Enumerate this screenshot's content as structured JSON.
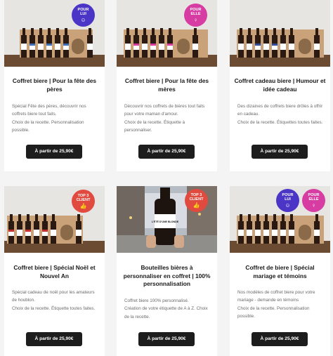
{
  "colors": {
    "lui": "#4a35c6",
    "elle": "#d63ca1",
    "top": "#e14a3e",
    "button": "#1d1d1d"
  },
  "cards": [
    {
      "title": "Coffret biere | Pour la fête des pères",
      "description": "Spécial Fête des pères, découvrir nos coffrets biere tout faits.\nChoix de la recette. Personnalisation possible.",
      "button": "À partir de 25,90€",
      "badges": [
        {
          "line1": "POUR",
          "line2": "LUI",
          "icon": "male-face-icon"
        }
      ]
    },
    {
      "title": "Coffret biere | Pour la fête des mères",
      "description": "Découvrir nos coffrets de bières tout faits pour votre maman d'amour.\nChoix de la recette. Étiquette à personnaliser.",
      "button": "À partir de 25,90€",
      "badges": [
        {
          "line1": "POUR",
          "line2": "ELLE",
          "icon": "female-face-icon"
        }
      ]
    },
    {
      "title": "Coffret cadeau biere | Humour et idée cadeau",
      "description": "Des dizaines de coffrets biere drôles à offrir en cadeau.\nChoix de la recette. Étiquettes toutes faites.",
      "button": "À partir de 25,90€",
      "badges": []
    },
    {
      "title": "Coffret biere | Spécial Noël et Nouvel An",
      "description": "Spécial cadeau de noël pour les amateurs de houblon.\nChoix de la recette. Étiquette toutes faites.",
      "button": "À partir de 25,90€",
      "badges": [
        {
          "line1": "TOP 3",
          "line2": "CLIENT",
          "icon": "thumbs-up-icon"
        }
      ]
    },
    {
      "title": "Bouteilles bières à personnaliser en coffret | 100% personnalisation",
      "description": "Coffret biere 100% personnalisé.\nCréation de votre étiquette de A à Z. Choix de la recette.",
      "button": "À partir de 25,90€",
      "photo_label": "L'ÉTÉ D'UNE BLONDE",
      "badges": [
        {
          "line1": "TOP 3",
          "line2": "CLIENT",
          "icon": "thumbs-up-icon"
        }
      ]
    },
    {
      "title": "Coffret de biere | Spécial mariage et témoins",
      "description": "Nos modèles de coffret biere pour votre mariage - demande en témoins\nChoix de la recette. Personnalisation possible.",
      "button": "À partir de 25,90€",
      "badges": [
        {
          "line1": "POUR",
          "line2": "LUI",
          "icon": "male-face-icon"
        },
        {
          "line1": "POUR",
          "line2": "ELLE",
          "icon": "female-face-icon"
        }
      ]
    }
  ]
}
